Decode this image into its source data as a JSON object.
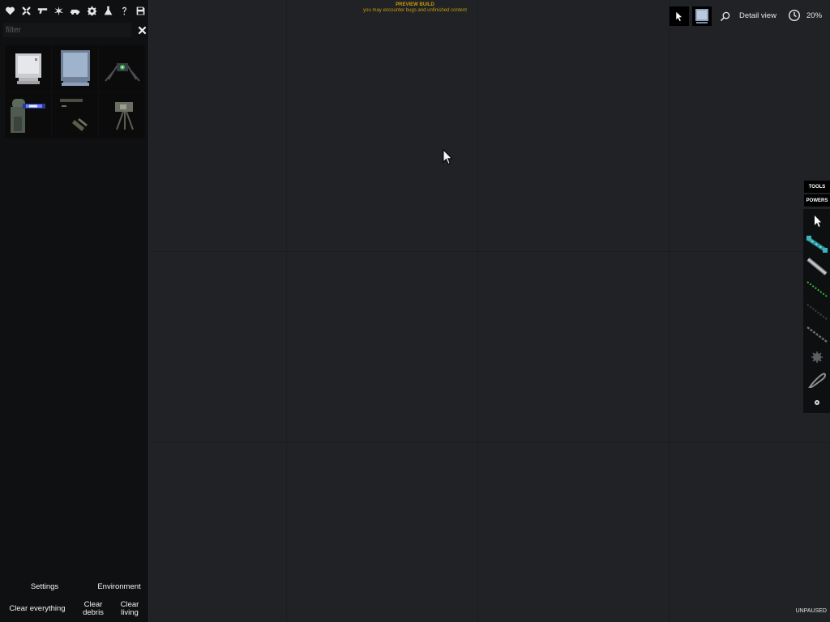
{
  "categories": [
    {
      "icon": "heart-icon"
    },
    {
      "icon": "crossed-swords-icon"
    },
    {
      "icon": "gun-icon"
    },
    {
      "icon": "explosive-icon"
    },
    {
      "icon": "vehicle-icon"
    },
    {
      "icon": "gear-icon"
    },
    {
      "icon": "flask-icon"
    },
    {
      "icon": "question-icon"
    },
    {
      "icon": "save-icon"
    }
  ],
  "filter": {
    "placeholder": "filter",
    "value": ""
  },
  "items": [
    {
      "name": "computer-screen-white"
    },
    {
      "name": "computer-screen-blue"
    },
    {
      "name": "spider-robot"
    },
    {
      "name": "plasma-turret"
    },
    {
      "name": "rifle-parts"
    },
    {
      "name": "camera-tripod"
    }
  ],
  "bottom": {
    "settings": "Settings",
    "environment": "Environment",
    "clear_everything": "Clear everything",
    "clear_debris": "Clear debris",
    "clear_living": "Clear living"
  },
  "banner": {
    "title": "PREVIEW BUILD",
    "subtitle": "you may encounter bugs and unfinished content"
  },
  "top_toolbar": {
    "detail_view": "Detail view",
    "time_scale": "20%"
  },
  "side_tabs": {
    "tools": "TOOLS",
    "powers": "POWERS"
  },
  "tools": [
    {
      "icon": "cursor-icon"
    },
    {
      "icon": "electric-wire-icon"
    },
    {
      "icon": "rod-icon"
    },
    {
      "icon": "green-cable-icon"
    },
    {
      "icon": "dark-cable-icon"
    },
    {
      "icon": "chain-icon"
    },
    {
      "icon": "gear-hinge-icon"
    },
    {
      "icon": "loop-rope-icon"
    },
    {
      "icon": "pin-icon"
    }
  ],
  "status": "UNPAUSED",
  "colors": {
    "banner": "#c99a0a",
    "background": "#202226",
    "panel": "#0f1011"
  }
}
